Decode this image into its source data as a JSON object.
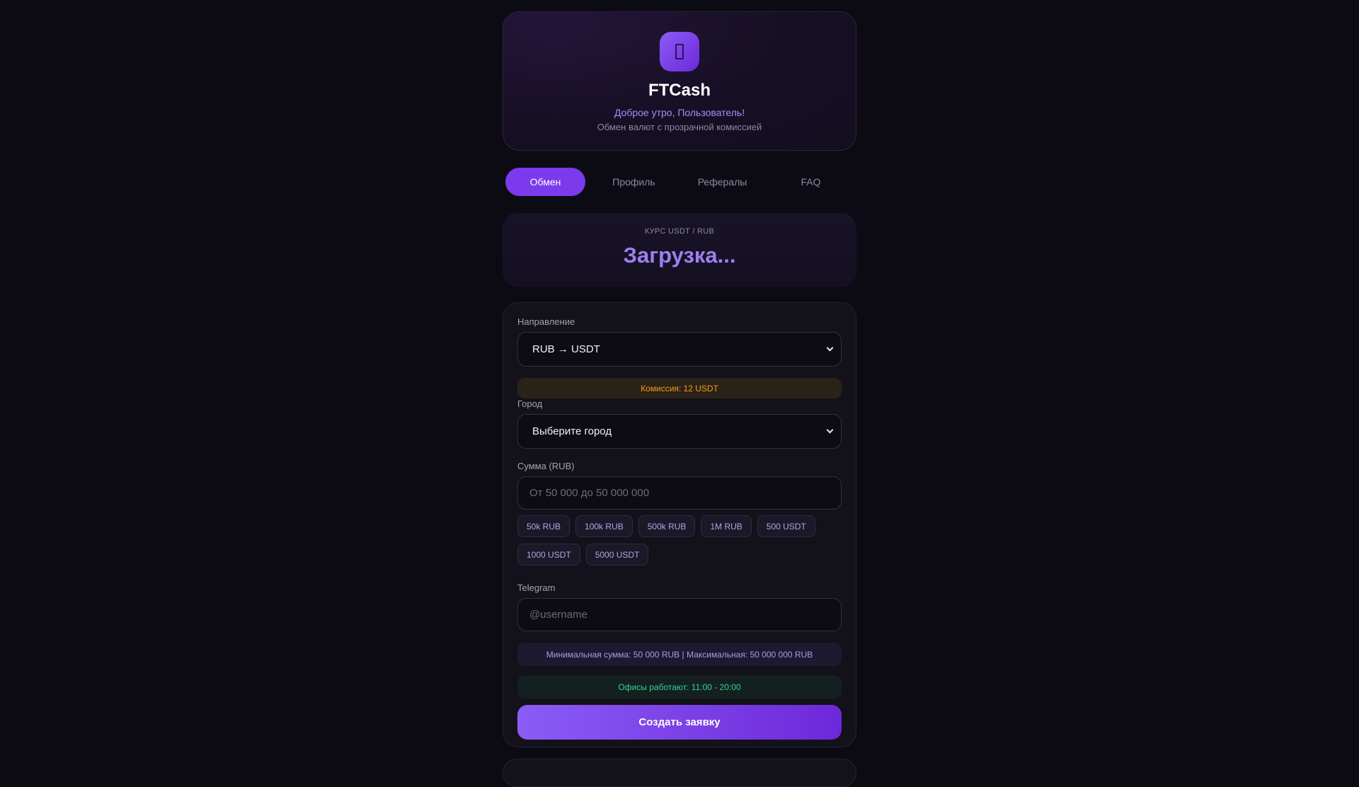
{
  "header": {
    "logo_icon": "wallet-icon",
    "title": "FTCash",
    "greeting": "Доброе утро, Пользователь!",
    "tagline": "Обмен валют с прозрачной комиссией"
  },
  "tabs": [
    {
      "label": "Обмен",
      "active": true
    },
    {
      "label": "Профиль",
      "active": false
    },
    {
      "label": "Рефералы",
      "active": false
    },
    {
      "label": "FAQ",
      "active": false
    }
  ],
  "rate": {
    "label": "КУРС USDT / RUB",
    "value": "Загрузка..."
  },
  "form": {
    "direction_label": "Направление",
    "direction_value": "RUB → USDT",
    "commission": "Комиссия: 12 USDT",
    "city_label": "Город",
    "city_value": "Выберите город",
    "amount_label": "Сумма (RUB)",
    "amount_placeholder": "От 50 000 до 50 000 000",
    "quick_amounts": [
      "50k RUB",
      "100k RUB",
      "500k RUB",
      "1M RUB",
      "500 USDT",
      "1000 USDT",
      "5000 USDT"
    ],
    "telegram_label": "Telegram",
    "telegram_placeholder": "@username",
    "range_info": "Минимальная сумма: 50 000 RUB | Максимальная: 50 000 000 RUB",
    "hours_info": "Офисы работают: 11:00 - 20:00",
    "submit_label": "Создать заявку"
  },
  "colors": {
    "accent": "#7c3aed",
    "background": "#0c0b14",
    "commission": "#f59e0b",
    "hours": "#34d399"
  }
}
